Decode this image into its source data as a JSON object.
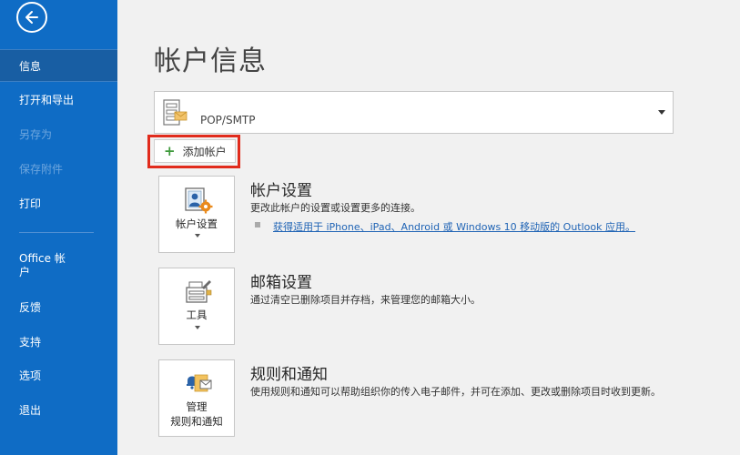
{
  "sidebar": {
    "items": [
      {
        "label": "信息"
      },
      {
        "label": "打开和导出"
      },
      {
        "label": "另存为"
      },
      {
        "label": "保存附件"
      },
      {
        "label": "打印"
      },
      {
        "label": "Office 帐户"
      },
      {
        "label": "反馈"
      },
      {
        "label": "支持"
      },
      {
        "label": "选项"
      },
      {
        "label": "退出"
      }
    ]
  },
  "main": {
    "title": "帐户信息",
    "account_select": {
      "value": "POP/SMTP"
    },
    "add_account_label": "添加帐户",
    "sections": [
      {
        "tile_label": "帐户设置",
        "title": "帐户设置",
        "description": "更改此帐户的设置或设置更多的连接。",
        "link": "获得适用于 iPhone、iPad、Android 或 Windows 10 移动版的 Outlook 应用。"
      },
      {
        "tile_label": "工具",
        "title": "邮箱设置",
        "description": "通过清空已删除项目并存档，来管理您的邮箱大小。"
      },
      {
        "tile_label_line1": "管理",
        "tile_label_line2": "规则和通知",
        "title": "规则和通知",
        "description": "使用规则和通知可以帮助组织你的传入电子邮件，并可在添加、更改或删除项目时收到更新。"
      }
    ]
  },
  "colors": {
    "sidebar": "#0f6cc5",
    "sidebar_active": "#185ea3",
    "highlight": "#e12b1c",
    "link": "#2064b5"
  }
}
